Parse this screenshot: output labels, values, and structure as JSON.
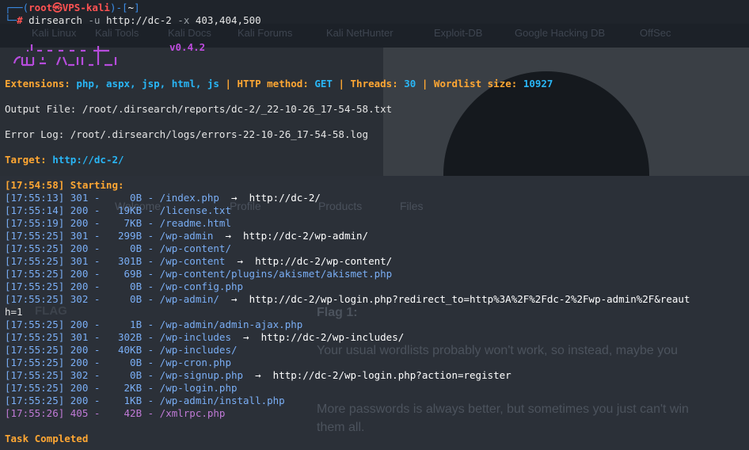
{
  "background_browser": {
    "bookmarks": [
      "Kali Linux",
      "Kali Tools",
      "Kali Docs",
      "Kali Forums",
      "Kali NetHunter",
      "Exploit-DB",
      "Google Hacking DB",
      "OffSec"
    ],
    "nav": [
      "Welcome",
      "Profile",
      "Products",
      "Files"
    ],
    "flag_heading": "FLAG",
    "flag_title": "Flag 1:",
    "paragraphs": [
      "Your usual wordlists probably won't work, so instead, maybe you",
      "More passwords is always better, but sometimes you just can't win",
      "them all."
    ]
  },
  "terminal": {
    "prompt": {
      "user": "root",
      "host": "VPS-kali",
      "path": "~",
      "command": "dirsearch",
      "args": " -u ",
      "url": "http://dc-2",
      "flag": " -x ",
      "flag_value": "403,404,500"
    },
    "version": "v0.4.2",
    "extensions_label": "Extensions:",
    "extensions_value": "php, aspx, jsp, html, js",
    "method_label": "HTTP method:",
    "method_value": "GET",
    "threads_label": "Threads:",
    "threads_value": "30",
    "wordlist_label": "Wordlist size:",
    "wordlist_value": "10927",
    "output_file": "Output File: /root/.dirsearch/reports/dc-2/_22-10-26_17-54-58.txt",
    "error_log": "Error Log: /root/.dirsearch/logs/errors-22-10-26_17-54-58.log",
    "target_label": "Target:",
    "target_value": "http://dc-2/",
    "starting": "[17:54:58] Starting:",
    "results": [
      {
        "time": "[17:55:13]",
        "code": "301",
        "size": "0B",
        "path": "/index.php",
        "redirect": "http://dc-2/"
      },
      {
        "time": "[17:55:14]",
        "code": "200",
        "size": "19KB",
        "path": "/license.txt",
        "redirect": ""
      },
      {
        "time": "[17:55:19]",
        "code": "200",
        "size": "7KB",
        "path": "/readme.html",
        "redirect": ""
      },
      {
        "time": "[17:55:25]",
        "code": "301",
        "size": "299B",
        "path": "/wp-admin",
        "redirect": "http://dc-2/wp-admin/"
      },
      {
        "time": "[17:55:25]",
        "code": "200",
        "size": "0B",
        "path": "/wp-content/",
        "redirect": ""
      },
      {
        "time": "[17:55:25]",
        "code": "301",
        "size": "301B",
        "path": "/wp-content",
        "redirect": "http://dc-2/wp-content/"
      },
      {
        "time": "[17:55:25]",
        "code": "200",
        "size": "69B",
        "path": "/wp-content/plugins/akismet/akismet.php",
        "redirect": ""
      },
      {
        "time": "[17:55:25]",
        "code": "200",
        "size": "0B",
        "path": "/wp-config.php",
        "redirect": ""
      },
      {
        "time": "[17:55:25]",
        "code": "302",
        "size": "0B",
        "path": "/wp-admin/",
        "redirect": "http://dc-2/wp-login.php?redirect_to=http%3A%2F%2Fdc-2%2Fwp-admin%2F&reaut"
      },
      {
        "time": "[17:55:25]",
        "code": "200",
        "size": "1B",
        "path": "/wp-admin/admin-ajax.php",
        "redirect": ""
      },
      {
        "time": "[17:55:25]",
        "code": "301",
        "size": "302B",
        "path": "/wp-includes",
        "redirect": "http://dc-2/wp-includes/"
      },
      {
        "time": "[17:55:25]",
        "code": "200",
        "size": "40KB",
        "path": "/wp-includes/",
        "redirect": ""
      },
      {
        "time": "[17:55:25]",
        "code": "200",
        "size": "0B",
        "path": "/wp-cron.php",
        "redirect": ""
      },
      {
        "time": "[17:55:25]",
        "code": "302",
        "size": "0B",
        "path": "/wp-signup.php",
        "redirect": "http://dc-2/wp-login.php?action=register"
      },
      {
        "time": "[17:55:25]",
        "code": "200",
        "size": "2KB",
        "path": "/wp-login.php",
        "redirect": ""
      },
      {
        "time": "[17:55:25]",
        "code": "200",
        "size": "1KB",
        "path": "/wp-admin/install.php",
        "redirect": ""
      },
      {
        "time": "[17:55:26]",
        "code": "405",
        "size": "42B",
        "path": "/xmlrpc.php",
        "redirect": ""
      }
    ],
    "wrap_line": "h=1",
    "task_completed": "Task Completed",
    "colors": {
      "status_ok": "#7aaef5",
      "status_405": "#c07ad6",
      "accent": "#ffa733",
      "value": "#29b6f6"
    }
  }
}
